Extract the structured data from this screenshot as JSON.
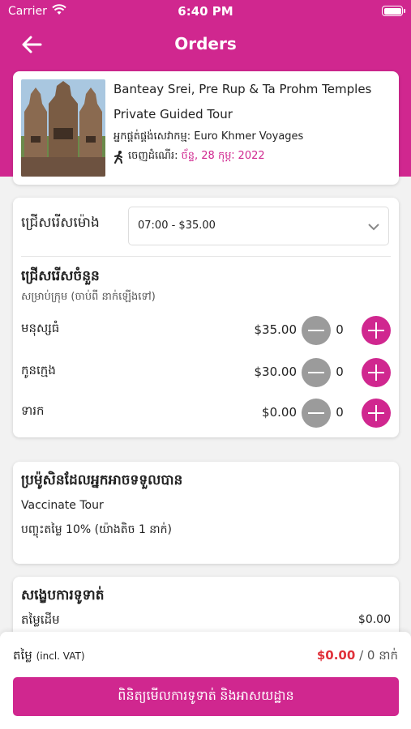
{
  "status_bar": {
    "carrier": "Carrier",
    "time": "6:40 PM"
  },
  "header": {
    "title": "Orders"
  },
  "tour": {
    "name": "Banteay Srei, Pre Rup & Ta Prohm Temples",
    "subtitle": "Private Guided Tour",
    "provider_label": "អ្នកផ្គត់ផ្គង់សេវាកម្ម:",
    "provider": "Euro Khmer Voyages",
    "depart_label": "ចេញដំណើរ:",
    "depart_date": "ច័ន្ទ, 28 កុម្ភៈ 2022"
  },
  "selection": {
    "time_label": "ជ្រើសរើសម៉ោង",
    "time_value": "07:00 - $35.00",
    "qty_title": "ជ្រើសរើសចំនួន",
    "qty_subtitle": "សម្រាប់ក្រុម (ចាប់ពី នាក់ឡើងទៅ)",
    "rows": [
      {
        "label": "មនុស្សធំ",
        "price": "$35.00",
        "count": "0"
      },
      {
        "label": "កូនក្មេង",
        "price": "$30.00",
        "count": "0"
      },
      {
        "label": "ទារក",
        "price": "$0.00",
        "count": "0"
      }
    ]
  },
  "promo": {
    "title": "ប្រម៉ូសិនដែលអ្នកអាចទទួលបាន",
    "name": "Vaccinate Tour",
    "desc": "បញ្ចុះតម្លៃ 10% (យ៉ាងតិច 1 នាក់)"
  },
  "summary": {
    "title": "សង្ខេបការទូទាត់",
    "base_label": "តម្លៃដើម",
    "base_value": "$0.00"
  },
  "footer": {
    "price_label": "តម្លៃ",
    "vat": "(incl. VAT)",
    "total": "$0.00",
    "per": "/ 0 នាក់",
    "cta": "ពិនិត្យមើលការទូទាត់ និងអាសយដ្ឋាន"
  },
  "colors": {
    "brand": "#d0278f",
    "price_red": "#e0313a"
  }
}
